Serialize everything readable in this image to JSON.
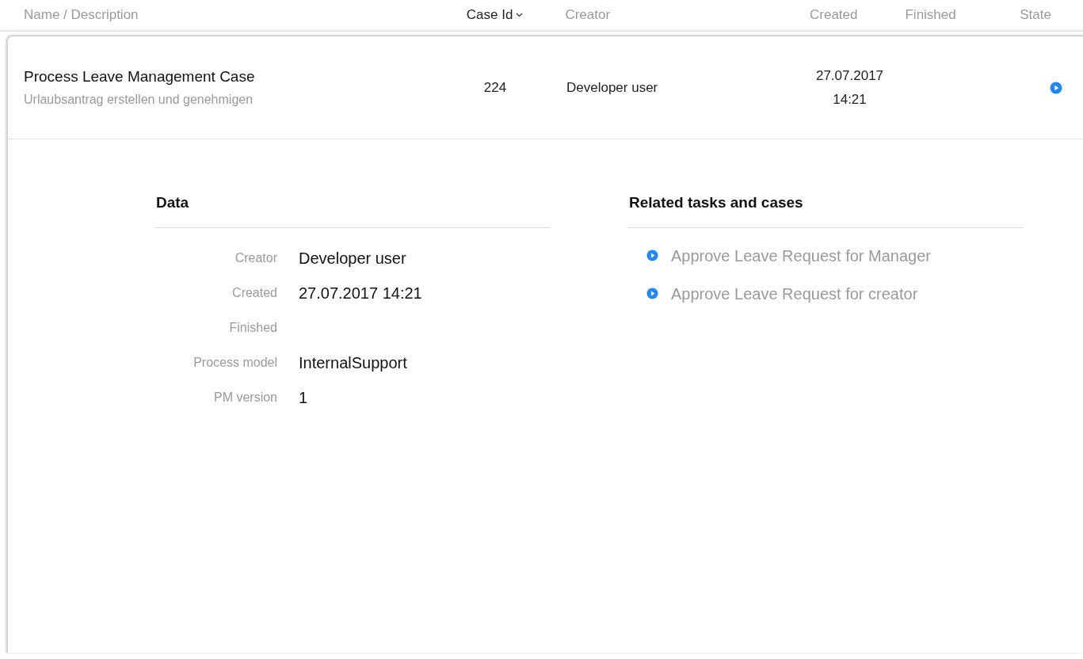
{
  "columns": [
    {
      "label": "Name / Description",
      "sorted": false
    },
    {
      "label": "Case Id",
      "sorted": true
    },
    {
      "label": "Creator",
      "sorted": false
    },
    {
      "label": "Created",
      "sorted": false
    },
    {
      "label": "Finished",
      "sorted": false
    },
    {
      "label": "State",
      "sorted": false
    }
  ],
  "case": {
    "name": "Process Leave Management Case",
    "description": "Urlaubsantrag erstellen und genehmigen",
    "case_id": "224",
    "creator": "Developer user",
    "created_date": "27.07.2017",
    "created_time": "14:21",
    "kind": "running"
  },
  "data_section": {
    "title": "Data",
    "fields": [
      {
        "label": "Creator",
        "value": "Developer user"
      },
      {
        "label": "Created",
        "value": "27.07.2017 14:21"
      },
      {
        "label": "Finished"
      },
      {
        "label": "Process model",
        "value": "InternalSupport"
      },
      {
        "label": "PM version",
        "value": "1"
      }
    ]
  },
  "related_section": {
    "title": "Related tasks and cases",
    "items": [
      {
        "label": "Approve Leave Request for Manager",
        "kind": "running"
      },
      {
        "label": "Approve Leave Request for creator",
        "kind": "running"
      }
    ]
  }
}
